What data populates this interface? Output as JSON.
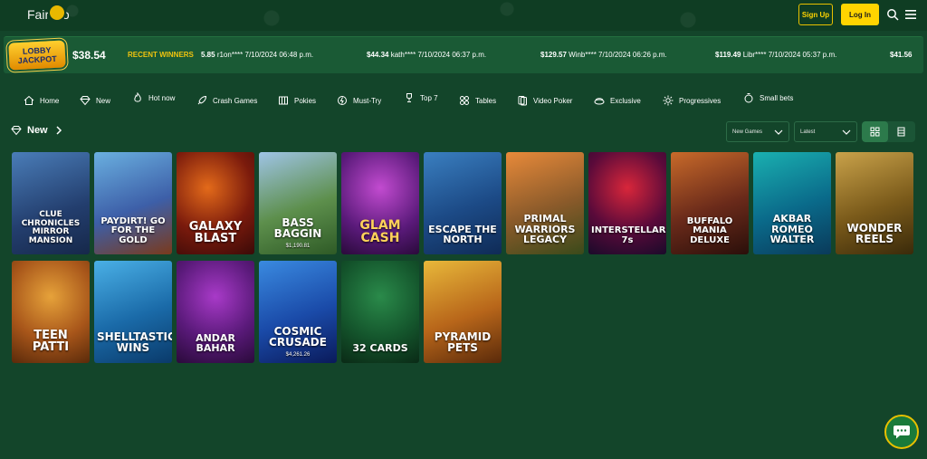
{
  "header": {
    "logo_text": "Fair Go",
    "signup_label": "Sign Up",
    "login_label": "Log In"
  },
  "jackpot": {
    "logo_line1": "LOBBY",
    "logo_line2": "JACKPOT",
    "amount": "$38.54"
  },
  "winners": {
    "label": "RECENT WINNERS",
    "items": [
      {
        "amount": "5.85",
        "text": "r1on**** 7/10/2024 06:48 p.m."
      },
      {
        "amount": "$44.34",
        "text": "kath**** 7/10/2024 06:37 p.m."
      },
      {
        "amount": "$129.57",
        "text": "Winb**** 7/10/2024 06:26 p.m."
      },
      {
        "amount": "$119.49",
        "text": "Libr**** 7/10/2024 05:37 p.m."
      },
      {
        "amount": "$41.56",
        "text": ""
      }
    ]
  },
  "categories": [
    {
      "label": "Home",
      "icon": "home-icon"
    },
    {
      "label": "New",
      "icon": "diamond-icon"
    },
    {
      "label": "Hot now",
      "icon": "flame-icon"
    },
    {
      "label": "Crash Games",
      "icon": "rocket-icon"
    },
    {
      "label": "Pokies",
      "icon": "slot-icon"
    },
    {
      "label": "Must-Try",
      "icon": "bolt-icon"
    },
    {
      "label": "Top 7",
      "icon": "trophy-icon"
    },
    {
      "label": "Tables",
      "icon": "cards-icon"
    },
    {
      "label": "Video Poker",
      "icon": "poker-icon"
    },
    {
      "label": "Exclusive",
      "icon": "crown-icon"
    },
    {
      "label": "Progressives",
      "icon": "sun-icon"
    },
    {
      "label": "Small bets",
      "icon": "coin-icon"
    }
  ],
  "section": {
    "title": "New",
    "filter1": "New Games",
    "filter2": "Latest"
  },
  "games": [
    {
      "title": "CLUE CHRONICLES MIRROR MANSION",
      "jackpot": ""
    },
    {
      "title": "PAYDIRT! GO FOR THE GOLD",
      "jackpot": ""
    },
    {
      "title": "GALAXY BLAST",
      "jackpot": ""
    },
    {
      "title": "BASS BAGGIN",
      "jackpot": "$1,190.81"
    },
    {
      "title": "GLAM CASH",
      "jackpot": ""
    },
    {
      "title": "ESCAPE THE NORTH",
      "jackpot": ""
    },
    {
      "title": "PRIMAL WARRIORS LEGACY",
      "jackpot": ""
    },
    {
      "title": "INTERSTELLAR 7s",
      "jackpot": ""
    },
    {
      "title": "BUFFALO MANIA DELUXE",
      "jackpot": ""
    },
    {
      "title": "AKBAR ROMEO WALTER",
      "jackpot": ""
    },
    {
      "title": "WONDER REELS",
      "jackpot": ""
    },
    {
      "title": "TEEN PATTI",
      "jackpot": ""
    },
    {
      "title": "SHELLTASTIC WINS",
      "jackpot": ""
    },
    {
      "title": "ANDAR BAHAR",
      "jackpot": ""
    },
    {
      "title": "COSMIC CRUSADE",
      "jackpot": "$4,261.26"
    },
    {
      "title": "32 CARDS",
      "jackpot": ""
    },
    {
      "title": "PYRAMID PETS",
      "jackpot": ""
    }
  ],
  "colors": {
    "background": "#13452a",
    "accent": "#ffd400"
  }
}
